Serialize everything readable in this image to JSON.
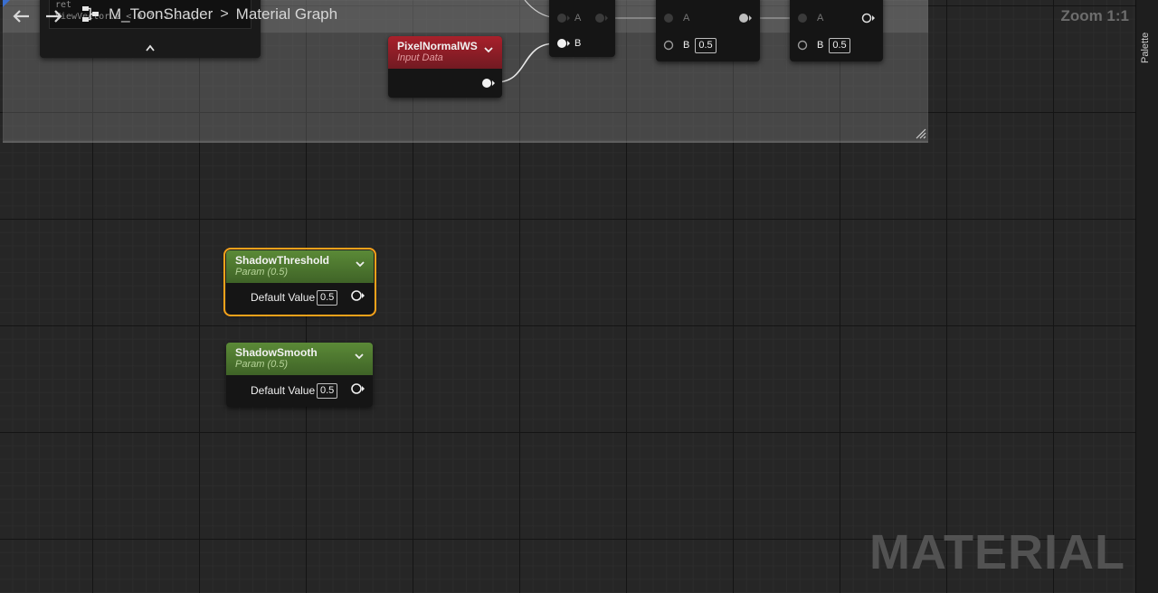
{
  "graph": {
    "asset_name": "M_ToonShader",
    "graph_name": "Material Graph",
    "breadcrumb_separator": ">",
    "zoom_label": "Zoom 1:1",
    "watermark": "MATERIAL"
  },
  "palette": {
    "label": "Palette"
  },
  "fragment_node": {
    "field_lines": [
      "ret",
      "ViewVector.z < 0 ? -1 : 1;"
    ]
  },
  "pixel_normal_node": {
    "title": "PixelNormalWS",
    "subtitle": "Input Data"
  },
  "math_nodes": [
    {
      "pin_a": "A",
      "pin_b": "B",
      "b_value": ""
    },
    {
      "pin_a": "A",
      "pin_b": "B",
      "b_value": "0.5"
    },
    {
      "pin_a": "A",
      "pin_b": "B",
      "b_value": "0.5"
    }
  ],
  "param_nodes": [
    {
      "title": "ShadowThreshold",
      "subtitle": "Param (0.5)",
      "pin_label": "Default Value",
      "value": "0.5"
    },
    {
      "title": "ShadowSmooth",
      "subtitle": "Param (0.5)",
      "pin_label": "Default Value",
      "value": "0.5"
    }
  ],
  "colors": {
    "param_header": "#4f7a31",
    "input_header": "#9a1f28",
    "selection": "#f6a21a",
    "wire": "#e8e8e8",
    "accent_corner": "#3a6fd0"
  }
}
